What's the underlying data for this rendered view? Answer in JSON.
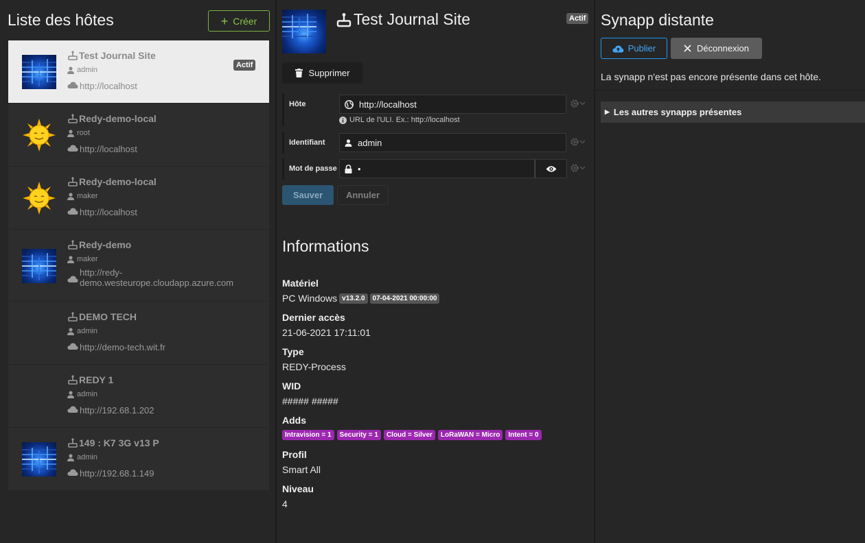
{
  "left": {
    "title": "Liste des hôtes",
    "create_label": "Créer",
    "hosts": [
      {
        "name": "Test Journal Site",
        "user": "admin",
        "url": "http://localhost",
        "badge": "Actif",
        "image": "circuit"
      },
      {
        "name": "Redy-demo-local",
        "user": "root",
        "url": "http://localhost",
        "image": "sun"
      },
      {
        "name": "Redy-demo-local",
        "user": "maker",
        "url": "http://localhost",
        "image": "sun"
      },
      {
        "name": "Redy-demo",
        "user": "maker",
        "url_line1": "http://redy-",
        "url_line2": "demo.westeurope.cloudapp.azure.com",
        "image": "circuit"
      },
      {
        "name": "DEMO TECH",
        "user": "admin",
        "url": "http://demo-tech.wit.fr",
        "image": "none"
      },
      {
        "name": "REDY 1",
        "user": "admin",
        "url": "http://192.68.1.202",
        "image": "none"
      },
      {
        "name": "149 : K7 3G v13 P",
        "user": "admin",
        "url": "http://192.68.1.149",
        "image": "circuit"
      }
    ]
  },
  "detail": {
    "title": "Test Journal Site",
    "badge": "Actif",
    "delete_label": "Supprimer",
    "form": {
      "host_label": "Hôte",
      "host_value": "http://localhost",
      "host_help": "URL de l'ULI. Ex.: http://localhost",
      "identifier_label": "Identifiant",
      "identifier_value": "admin",
      "password_label": "Mot de passe",
      "password_value": "•"
    },
    "save_label": "Sauver",
    "cancel_label": "Annuler",
    "info": {
      "title": "Informations",
      "materiel_label": "Matériel",
      "materiel_value": "PC Windows",
      "materiel_version": "v13.2.0",
      "materiel_date": "07-04-2021 00:00:00",
      "last_access_label": "Dernier accès",
      "last_access_value": "21-06-2021 17:11:01",
      "type_label": "Type",
      "type_value": "REDY-Process",
      "wid_label": "WID",
      "wid_value": "##### #####",
      "adds_label": "Adds",
      "adds": [
        "Intravision = 1",
        "Security = 1",
        "Cloud = Silver",
        "LoRaWAN = Micro",
        "Intent = 0"
      ],
      "profil_label": "Profil",
      "profil_value": "Smart All",
      "niveau_label": "Niveau",
      "niveau_value": "4"
    }
  },
  "remote": {
    "title": "Synapp distante",
    "publish_label": "Publier",
    "disconnect_label": "Déconnexion",
    "message": "La synapp n'est pas encore présente dans cet hôte.",
    "details_label": "Les autres synapps présentes"
  },
  "colors": {
    "background": "#262626",
    "accent_green": "#8bc34a",
    "accent_blue": "#2196f3",
    "tag_purple": "#9c27b0",
    "active_row": "#ececec"
  }
}
